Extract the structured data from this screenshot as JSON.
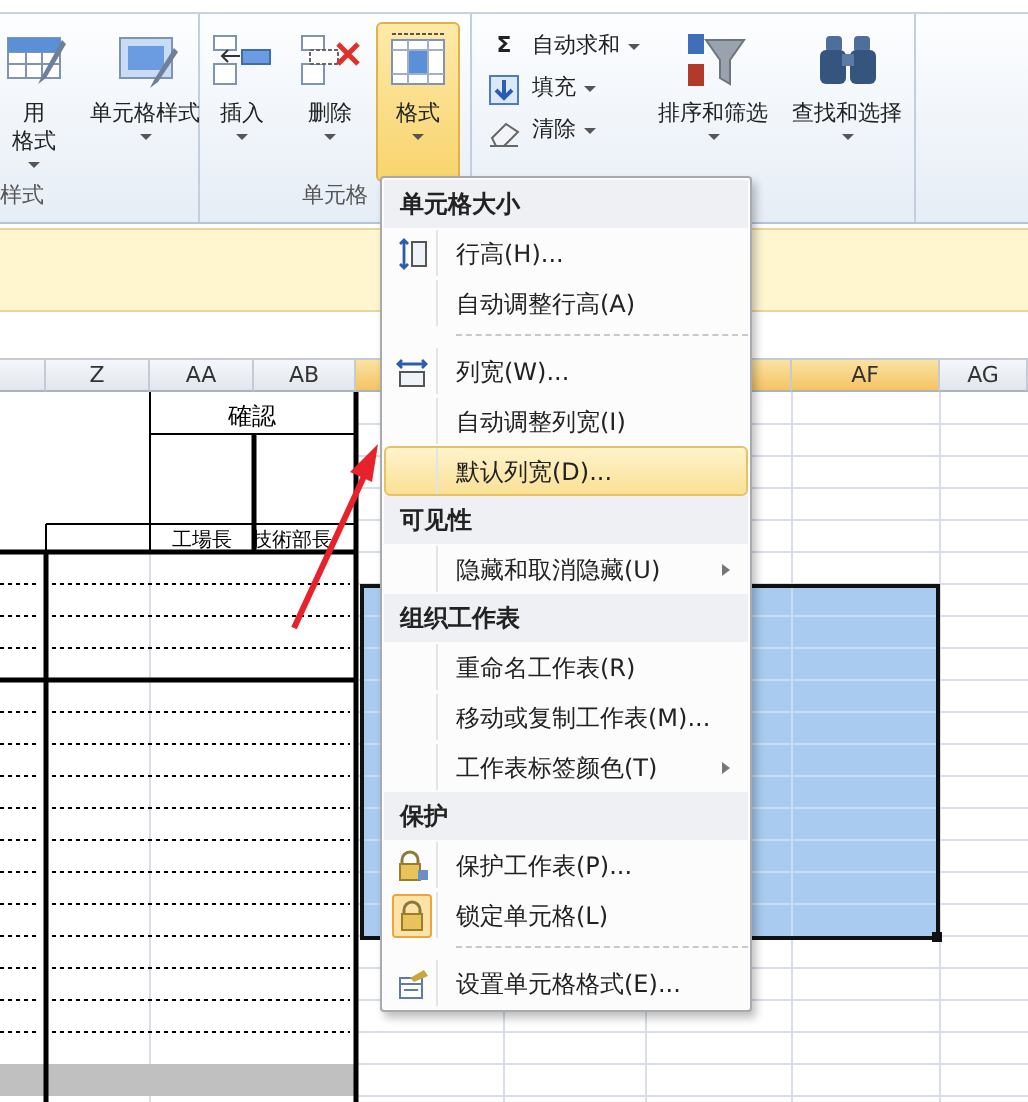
{
  "ribbon": {
    "groups": [
      {
        "label": "样式",
        "items": [
          {
            "kind": "large",
            "lines": [
              "用",
              "格式"
            ],
            "dropdown": true,
            "selected": false
          },
          {
            "kind": "large",
            "lines": [
              "单元格样式"
            ],
            "dropdown": true,
            "selected": false
          }
        ]
      },
      {
        "label": "单元格",
        "items": [
          {
            "kind": "large",
            "lines": [
              "插入"
            ],
            "dropdown": true,
            "selected": false
          },
          {
            "kind": "large",
            "lines": [
              "删除"
            ],
            "dropdown": true,
            "selected": false
          },
          {
            "kind": "large",
            "lines": [
              "格式"
            ],
            "dropdown": true,
            "selected": true
          }
        ]
      },
      {
        "items": [
          {
            "kind": "stack",
            "buttons": [
              {
                "symbol": "Σ",
                "label": "自动求和",
                "dropdown": true
              },
              {
                "label": "填充",
                "dropdown": true
              },
              {
                "label": "清除",
                "dropdown": true
              }
            ]
          },
          {
            "kind": "large",
            "lines": [
              "排序和筛选"
            ],
            "dropdown": true,
            "selected": false
          },
          {
            "kind": "large",
            "lines": [
              "查找和选择"
            ],
            "dropdown": true,
            "selected": false
          }
        ]
      }
    ]
  },
  "sheet": {
    "columns": [
      {
        "selected": false
      },
      {
        "label": "Z",
        "selected": false
      },
      {
        "label": "AA",
        "selected": false
      },
      {
        "label": "AB",
        "selected": false
      },
      {
        "selected": true
      },
      {
        "selected": true
      },
      {
        "label": "AF",
        "selected": true
      },
      {
        "label": "AG",
        "selected": false
      }
    ],
    "form": {
      "title": "確認",
      "signers": [
        "工場長",
        "技術部長"
      ]
    }
  },
  "menu": {
    "sections": [
      {
        "title": "单元格大小",
        "items": [
          {
            "label": "行高(H)...",
            "selected": false,
            "submenu": false,
            "checked": false
          },
          {
            "label": "自动调整行高(A)",
            "selected": false,
            "submenu": false,
            "checked": false
          },
          {
            "label": "列宽(W)...",
            "selected": false,
            "submenu": false,
            "checked": false,
            "separator_before": true
          },
          {
            "label": "自动调整列宽(I)",
            "selected": false,
            "submenu": false,
            "checked": false
          },
          {
            "label": "默认列宽(D)...",
            "selected": true,
            "submenu": false,
            "checked": false
          }
        ]
      },
      {
        "title": "可见性",
        "items": [
          {
            "label": "隐藏和取消隐藏(U)",
            "selected": false,
            "submenu": true,
            "checked": false
          }
        ]
      },
      {
        "title": "组织工作表",
        "items": [
          {
            "label": "重命名工作表(R)",
            "selected": false,
            "submenu": false,
            "checked": false
          },
          {
            "label": "移动或复制工作表(M)...",
            "selected": false,
            "submenu": false,
            "checked": false
          },
          {
            "label": "工作表标签颜色(T)",
            "selected": false,
            "submenu": true,
            "checked": false
          }
        ]
      },
      {
        "title": "保护",
        "items": [
          {
            "label": "保护工作表(P)...",
            "selected": false,
            "submenu": false,
            "checked": false
          },
          {
            "label": "锁定单元格(L)",
            "selected": false,
            "submenu": false,
            "checked": true
          },
          {
            "label": "设置单元格格式(E)...",
            "selected": false,
            "submenu": false,
            "checked": false,
            "separator_before": true
          }
        ]
      }
    ]
  }
}
